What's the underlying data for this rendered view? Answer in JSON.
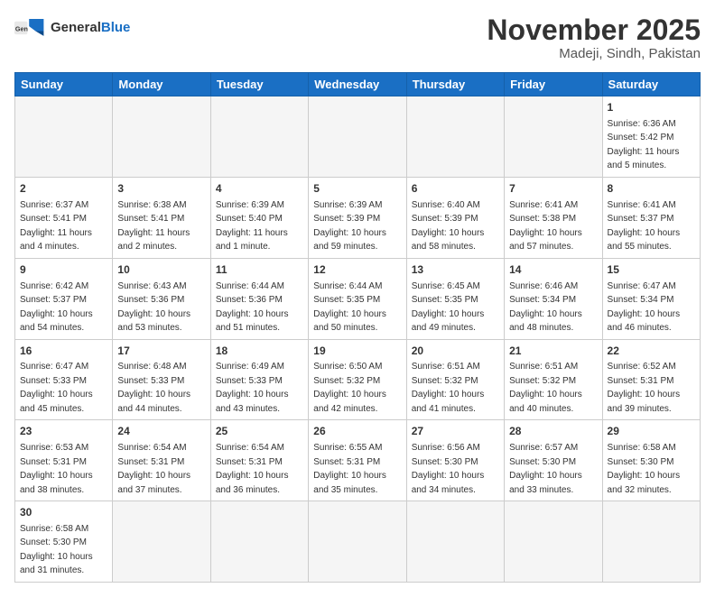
{
  "header": {
    "logo_general": "General",
    "logo_blue": "Blue",
    "month_title": "November 2025",
    "location": "Madeji, Sindh, Pakistan"
  },
  "columns": [
    "Sunday",
    "Monday",
    "Tuesday",
    "Wednesday",
    "Thursday",
    "Friday",
    "Saturday"
  ],
  "weeks": [
    [
      {
        "day": "",
        "info": ""
      },
      {
        "day": "",
        "info": ""
      },
      {
        "day": "",
        "info": ""
      },
      {
        "day": "",
        "info": ""
      },
      {
        "day": "",
        "info": ""
      },
      {
        "day": "",
        "info": ""
      },
      {
        "day": "1",
        "info": "Sunrise: 6:36 AM\nSunset: 5:42 PM\nDaylight: 11 hours and 5 minutes."
      }
    ],
    [
      {
        "day": "2",
        "info": "Sunrise: 6:37 AM\nSunset: 5:41 PM\nDaylight: 11 hours and 4 minutes."
      },
      {
        "day": "3",
        "info": "Sunrise: 6:38 AM\nSunset: 5:41 PM\nDaylight: 11 hours and 2 minutes."
      },
      {
        "day": "4",
        "info": "Sunrise: 6:39 AM\nSunset: 5:40 PM\nDaylight: 11 hours and 1 minute."
      },
      {
        "day": "5",
        "info": "Sunrise: 6:39 AM\nSunset: 5:39 PM\nDaylight: 10 hours and 59 minutes."
      },
      {
        "day": "6",
        "info": "Sunrise: 6:40 AM\nSunset: 5:39 PM\nDaylight: 10 hours and 58 minutes."
      },
      {
        "day": "7",
        "info": "Sunrise: 6:41 AM\nSunset: 5:38 PM\nDaylight: 10 hours and 57 minutes."
      },
      {
        "day": "8",
        "info": "Sunrise: 6:41 AM\nSunset: 5:37 PM\nDaylight: 10 hours and 55 minutes."
      }
    ],
    [
      {
        "day": "9",
        "info": "Sunrise: 6:42 AM\nSunset: 5:37 PM\nDaylight: 10 hours and 54 minutes."
      },
      {
        "day": "10",
        "info": "Sunrise: 6:43 AM\nSunset: 5:36 PM\nDaylight: 10 hours and 53 minutes."
      },
      {
        "day": "11",
        "info": "Sunrise: 6:44 AM\nSunset: 5:36 PM\nDaylight: 10 hours and 51 minutes."
      },
      {
        "day": "12",
        "info": "Sunrise: 6:44 AM\nSunset: 5:35 PM\nDaylight: 10 hours and 50 minutes."
      },
      {
        "day": "13",
        "info": "Sunrise: 6:45 AM\nSunset: 5:35 PM\nDaylight: 10 hours and 49 minutes."
      },
      {
        "day": "14",
        "info": "Sunrise: 6:46 AM\nSunset: 5:34 PM\nDaylight: 10 hours and 48 minutes."
      },
      {
        "day": "15",
        "info": "Sunrise: 6:47 AM\nSunset: 5:34 PM\nDaylight: 10 hours and 46 minutes."
      }
    ],
    [
      {
        "day": "16",
        "info": "Sunrise: 6:47 AM\nSunset: 5:33 PM\nDaylight: 10 hours and 45 minutes."
      },
      {
        "day": "17",
        "info": "Sunrise: 6:48 AM\nSunset: 5:33 PM\nDaylight: 10 hours and 44 minutes."
      },
      {
        "day": "18",
        "info": "Sunrise: 6:49 AM\nSunset: 5:33 PM\nDaylight: 10 hours and 43 minutes."
      },
      {
        "day": "19",
        "info": "Sunrise: 6:50 AM\nSunset: 5:32 PM\nDaylight: 10 hours and 42 minutes."
      },
      {
        "day": "20",
        "info": "Sunrise: 6:51 AM\nSunset: 5:32 PM\nDaylight: 10 hours and 41 minutes."
      },
      {
        "day": "21",
        "info": "Sunrise: 6:51 AM\nSunset: 5:32 PM\nDaylight: 10 hours and 40 minutes."
      },
      {
        "day": "22",
        "info": "Sunrise: 6:52 AM\nSunset: 5:31 PM\nDaylight: 10 hours and 39 minutes."
      }
    ],
    [
      {
        "day": "23",
        "info": "Sunrise: 6:53 AM\nSunset: 5:31 PM\nDaylight: 10 hours and 38 minutes."
      },
      {
        "day": "24",
        "info": "Sunrise: 6:54 AM\nSunset: 5:31 PM\nDaylight: 10 hours and 37 minutes."
      },
      {
        "day": "25",
        "info": "Sunrise: 6:54 AM\nSunset: 5:31 PM\nDaylight: 10 hours and 36 minutes."
      },
      {
        "day": "26",
        "info": "Sunrise: 6:55 AM\nSunset: 5:31 PM\nDaylight: 10 hours and 35 minutes."
      },
      {
        "day": "27",
        "info": "Sunrise: 6:56 AM\nSunset: 5:30 PM\nDaylight: 10 hours and 34 minutes."
      },
      {
        "day": "28",
        "info": "Sunrise: 6:57 AM\nSunset: 5:30 PM\nDaylight: 10 hours and 33 minutes."
      },
      {
        "day": "29",
        "info": "Sunrise: 6:58 AM\nSunset: 5:30 PM\nDaylight: 10 hours and 32 minutes."
      }
    ],
    [
      {
        "day": "30",
        "info": "Sunrise: 6:58 AM\nSunset: 5:30 PM\nDaylight: 10 hours and 31 minutes."
      },
      {
        "day": "",
        "info": ""
      },
      {
        "day": "",
        "info": ""
      },
      {
        "day": "",
        "info": ""
      },
      {
        "day": "",
        "info": ""
      },
      {
        "day": "",
        "info": ""
      },
      {
        "day": "",
        "info": ""
      }
    ]
  ]
}
